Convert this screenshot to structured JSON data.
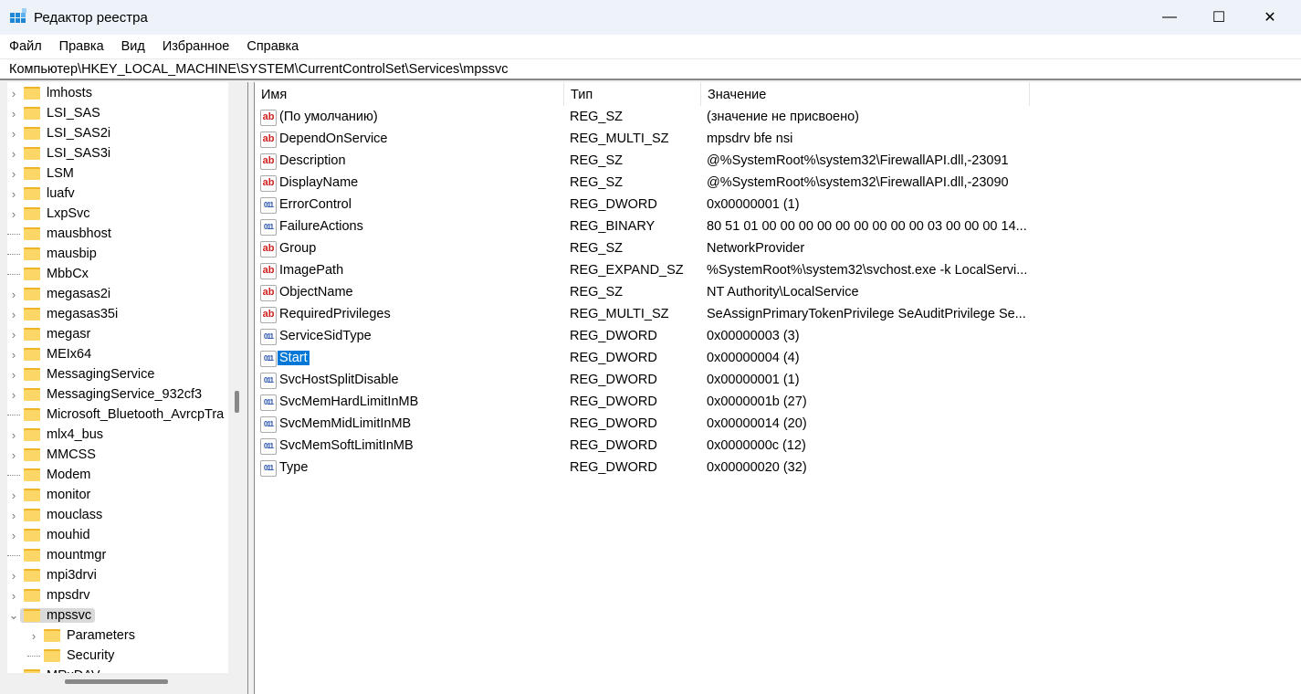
{
  "window": {
    "title": "Редактор реестра",
    "minimize": "—",
    "maximize": "☐",
    "close": "✕"
  },
  "menu": [
    "Файл",
    "Правка",
    "Вид",
    "Избранное",
    "Справка"
  ],
  "address": "Компьютер\\HKEY_LOCAL_MACHINE\\SYSTEM\\CurrentControlSet\\Services\\mpssvc",
  "tree": [
    {
      "label": "lmhosts",
      "expandable": true
    },
    {
      "label": "LSI_SAS",
      "expandable": true
    },
    {
      "label": "LSI_SAS2i",
      "expandable": true
    },
    {
      "label": "LSI_SAS3i",
      "expandable": true
    },
    {
      "label": "LSM",
      "expandable": true
    },
    {
      "label": "luafv",
      "expandable": true
    },
    {
      "label": "LxpSvc",
      "expandable": true
    },
    {
      "label": "mausbhost",
      "expandable": false
    },
    {
      "label": "mausbip",
      "expandable": false
    },
    {
      "label": "MbbCx",
      "expandable": false
    },
    {
      "label": "megasas2i",
      "expandable": true
    },
    {
      "label": "megasas35i",
      "expandable": true
    },
    {
      "label": "megasr",
      "expandable": true
    },
    {
      "label": "MEIx64",
      "expandable": true
    },
    {
      "label": "MessagingService",
      "expandable": true
    },
    {
      "label": "MessagingService_932cf3",
      "expandable": true
    },
    {
      "label": "Microsoft_Bluetooth_AvrcpTra",
      "expandable": false
    },
    {
      "label": "mlx4_bus",
      "expandable": true
    },
    {
      "label": "MMCSS",
      "expandable": true
    },
    {
      "label": "Modem",
      "expandable": false
    },
    {
      "label": "monitor",
      "expandable": true
    },
    {
      "label": "mouclass",
      "expandable": true
    },
    {
      "label": "mouhid",
      "expandable": true
    },
    {
      "label": "mountmgr",
      "expandable": false
    },
    {
      "label": "mpi3drvi",
      "expandable": true
    },
    {
      "label": "mpsdrv",
      "expandable": true
    },
    {
      "label": "mpssvc",
      "expandable": true,
      "expanded": true,
      "selected": true
    },
    {
      "label": "Parameters",
      "expandable": true,
      "child": true
    },
    {
      "label": "Security",
      "expandable": false,
      "child": true
    },
    {
      "label": "MRxDAV",
      "expandable": true,
      "partial": true
    }
  ],
  "columns": [
    "Имя",
    "Тип",
    "Значение"
  ],
  "values": [
    {
      "name": "(По умолчанию)",
      "type": "REG_SZ",
      "data": "(значение не присвоено)",
      "icon": "string"
    },
    {
      "name": "DependOnService",
      "type": "REG_MULTI_SZ",
      "data": "mpsdrv bfe nsi",
      "icon": "string"
    },
    {
      "name": "Description",
      "type": "REG_SZ",
      "data": "@%SystemRoot%\\system32\\FirewallAPI.dll,-23091",
      "icon": "string"
    },
    {
      "name": "DisplayName",
      "type": "REG_SZ",
      "data": "@%SystemRoot%\\system32\\FirewallAPI.dll,-23090",
      "icon": "string"
    },
    {
      "name": "ErrorControl",
      "type": "REG_DWORD",
      "data": "0x00000001 (1)",
      "icon": "binary"
    },
    {
      "name": "FailureActions",
      "type": "REG_BINARY",
      "data": "80 51 01 00 00 00 00 00 00 00 00 00 03 00 00 00 14...",
      "icon": "binary"
    },
    {
      "name": "Group",
      "type": "REG_SZ",
      "data": "NetworkProvider",
      "icon": "string"
    },
    {
      "name": "ImagePath",
      "type": "REG_EXPAND_SZ",
      "data": "%SystemRoot%\\system32\\svchost.exe -k LocalServi...",
      "icon": "string"
    },
    {
      "name": "ObjectName",
      "type": "REG_SZ",
      "data": "NT Authority\\LocalService",
      "icon": "string"
    },
    {
      "name": "RequiredPrivileges",
      "type": "REG_MULTI_SZ",
      "data": "SeAssignPrimaryTokenPrivilege SeAuditPrivilege Se...",
      "icon": "string"
    },
    {
      "name": "ServiceSidType",
      "type": "REG_DWORD",
      "data": "0x00000003 (3)",
      "icon": "binary"
    },
    {
      "name": "Start",
      "type": "REG_DWORD",
      "data": "0x00000004 (4)",
      "icon": "binary",
      "selected": true
    },
    {
      "name": "SvcHostSplitDisable",
      "type": "REG_DWORD",
      "data": "0x00000001 (1)",
      "icon": "binary"
    },
    {
      "name": "SvcMemHardLimitInMB",
      "type": "REG_DWORD",
      "data": "0x0000001b (27)",
      "icon": "binary"
    },
    {
      "name": "SvcMemMidLimitInMB",
      "type": "REG_DWORD",
      "data": "0x00000014 (20)",
      "icon": "binary"
    },
    {
      "name": "SvcMemSoftLimitInMB",
      "type": "REG_DWORD",
      "data": "0x0000000c (12)",
      "icon": "binary"
    },
    {
      "name": "Type",
      "type": "REG_DWORD",
      "data": "0x00000020 (32)",
      "icon": "binary"
    }
  ],
  "colors": {
    "selection": "#0078d7",
    "titlebar": "#eef3fa",
    "folder": "#fcd667"
  }
}
